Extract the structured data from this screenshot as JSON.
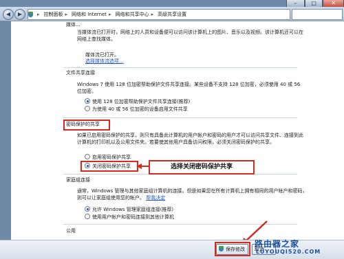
{
  "window_controls": {
    "minimize": "–",
    "maximize": "□",
    "close": "✕"
  },
  "addressbar": {
    "crumbs": [
      "控制面板",
      "网络和 Internet",
      "网络和共享中心",
      "高级共享设置"
    ],
    "separator": "▸"
  },
  "sections": {
    "partial_top_heading": "媒体...",
    "media_description": "当媒体流已打开时，网络上的人员和设备便可以访问该计算机上的图片、音乐以及视频。该计算机还可以在网络上查找媒体。",
    "media_status": "媒体流已打开。",
    "media_link": "选择媒体流选项...",
    "file_sharing_heading": "文件共享连接",
    "file_sharing_description": "Windows 7 使用 128 位加密帮助保护文件共享连接。某些设备不支持 128 位加密，必须使用 40 或 56 位加密。",
    "file_sharing_options": [
      {
        "label": "使用 128 位加密帮助保护文件共享连接(推荐)",
        "selected": true
      },
      {
        "label": "为使用 40 或 56 位加密的设备启用文件共享",
        "selected": false
      }
    ],
    "password_heading": "密码保护的共享",
    "password_description": "如果已启用密码保护的共享，则只有具备此计算机的用户帐户和密码的用户才可以访问共享文件、连接到此计算机的打印机以及公用文件夹。若要使其他用户具备访问权限，必须关闭密码保护的共享。",
    "password_options": [
      {
        "label": "启用密码保护共享",
        "selected": false
      },
      {
        "label": "关闭密码保护共享",
        "selected": true
      }
    ],
    "homegroup_heading": "家庭组连接",
    "homegroup_description": "通常，Windows 管理与其他家庭组计算机的连接。但是如果您在所有计算机上拥有相同的用户帐户和密码，则可以让家庭组使用您的帐户。",
    "homegroup_link": "帮我决定",
    "homegroup_options": [
      {
        "label": "允许 Windows 管理家庭组连接(推荐)",
        "selected": true
      },
      {
        "label": "使用用户帐户和密码连接到其他计算机",
        "selected": false
      }
    ],
    "public_heading": "公用"
  },
  "annotation": {
    "callout_text": "选择关闭密码保护共享"
  },
  "buttons": {
    "save": "保存修改",
    "cancel": "取消"
  },
  "watermark": {
    "line1": "路由器之家",
    "line2": "LUYOUQI520.COM"
  },
  "colors": {
    "annotation_red": "#d72a1d",
    "link_blue": "#1f55c4"
  }
}
